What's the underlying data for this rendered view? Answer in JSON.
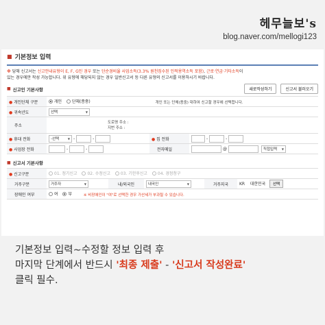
{
  "watermark": {
    "title": "헤무늘보's",
    "url": "blog.naver.com/mellogi123"
  },
  "section": {
    "title": "기본정보 입력"
  },
  "notice": {
    "line1_a": "당해 신고서는 ",
    "line1_b": "신고안내유형이 E, F, G인 경우",
    "line1_c": " 또는 ",
    "line1_d": "단순경비율 사업소득(3.3% 원천징수된 인적용역소득 포함)",
    "line1_e": ", ",
    "line1_f": "근로·연금·기타소득",
    "line1_g": "이",
    "line2": "있는 경우에만 작성 가능합니다. 위 유형에 해당되지 않는 경우 일반신고서 등 다른 유형의 신고서를 이용하시기 바랍니다."
  },
  "filer": {
    "header": "신고인 기본사항",
    "buttons": {
      "new": "새로작성하기",
      "load": "신고서 불러오기"
    },
    "rows": {
      "type_label": "개인단체 구분",
      "type_options": [
        "개인",
        "단체(종중)"
      ],
      "type_hint": "개인 또는 단체(종중) 대하여 신고할 경우에 선택합니다.",
      "year_label": "귀속년도",
      "year_select": "선택",
      "address_label": "주소",
      "road_addr": "도로명 주소 :",
      "lot_addr": "지번 주소 :",
      "mobile_label": "휴대 전화",
      "mobile_select": "-선택",
      "home_label": "집 전화",
      "work_label": "사업장 전화",
      "email_label": "전자메일",
      "email_at": "@",
      "email_select": "직접입력"
    }
  },
  "report": {
    "header": "신고서 기본사항",
    "type_label": "신고구분",
    "type_options": [
      "01. 정기신고",
      "02. 수정신고",
      "03. 기한후신고",
      "04. 경정청구"
    ],
    "resident_label": "거주구분",
    "resident_select": "거주자",
    "nationality_label": "내/외국인",
    "nationality_select": "내국인",
    "region_label": "거주지국",
    "region_code": "KR",
    "region_name": "대한민국",
    "region_btn": "선택",
    "disabled_label": "장애인 여부",
    "disabled_options": [
      "여",
      "부"
    ],
    "disabled_hint": "※ 비장애인이 \"여\"로 선택한 경우 가산세가 부과될 수 있습니다."
  },
  "caption": {
    "line1": "기본정보 입력~수정할 정보 입력 후",
    "line2_a": "마지막 단계에서 반드시 ",
    "line2_b": "'최종 제출'",
    "line2_c": " - ",
    "line2_d": "'신고서 작성완료'",
    "line3": "클릭 필수."
  }
}
